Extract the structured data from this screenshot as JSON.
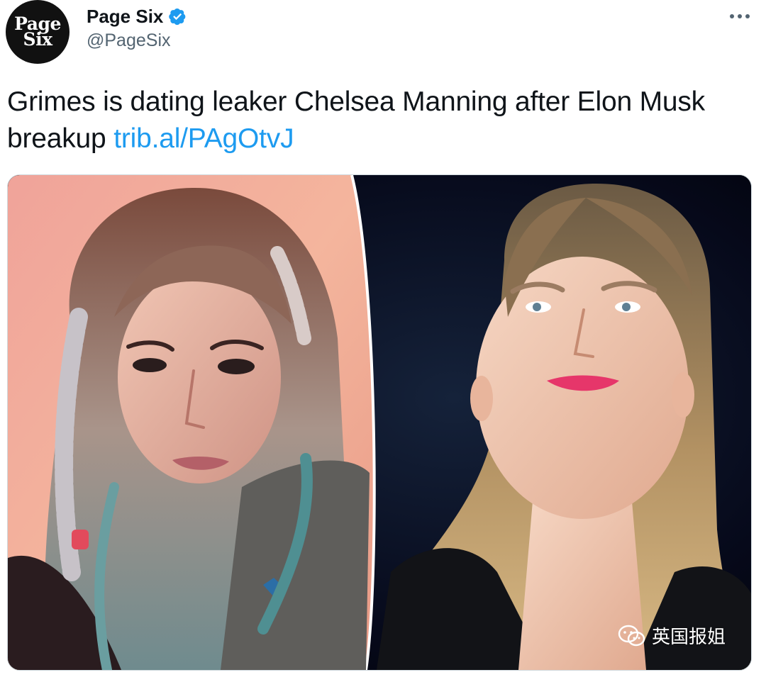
{
  "author": {
    "avatar_text_line1": "Page",
    "avatar_text_line2": "Six",
    "name": "Page Six",
    "handle": "@PageSix",
    "verified": true
  },
  "tweet": {
    "text": "Grimes is dating leaker Chelsea Manning after Elon Musk breakup",
    "link": "trib.al/PAgOtvJ"
  },
  "media": {
    "left_photo": "photo-grimes",
    "right_photo": "photo-chelsea-manning"
  },
  "watermark": {
    "text": "英国报姐"
  },
  "colors": {
    "link": "#1d9bf0",
    "verified": "#1d9bf0",
    "text": "#0f1419",
    "secondary": "#536471"
  }
}
